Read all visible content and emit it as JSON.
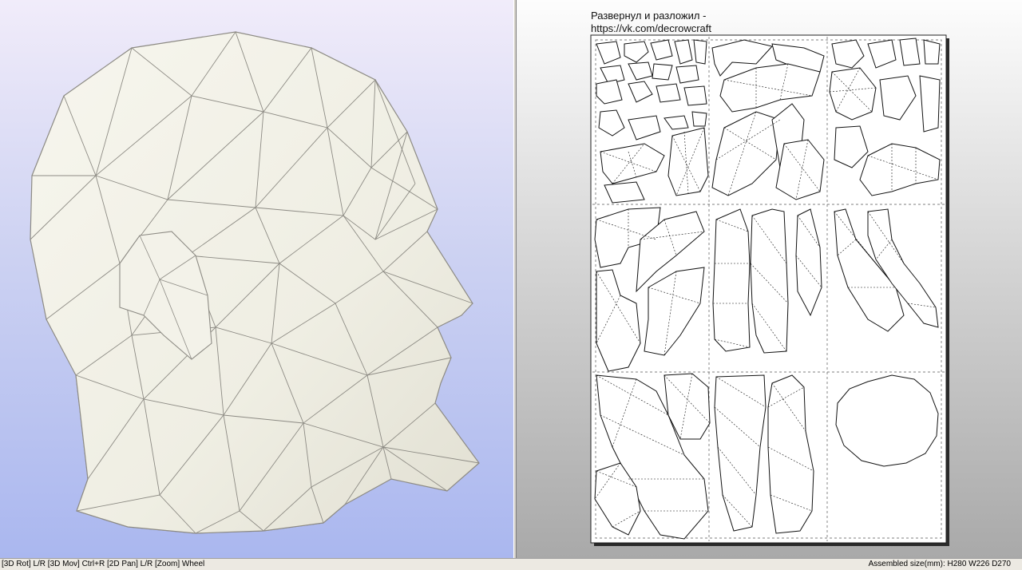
{
  "viewer": {
    "credit_line1": "Развернул и разложил -",
    "credit_line2": "https://vk.com/decrowcraft"
  },
  "status": {
    "controls": "[3D Rot] L/R [3D Mov] Ctrl+R [2D Pan] L/R [Zoom] Wheel",
    "assembled": "Assembled size(mm): H280 W226 D270"
  },
  "colors": {
    "bg3d_top": "#f1ecfa",
    "bg3d_bottom": "#aab7ef",
    "model_fill": "#f1f0e6",
    "model_edge": "#8d8b84",
    "sheet": "#ffffff"
  }
}
